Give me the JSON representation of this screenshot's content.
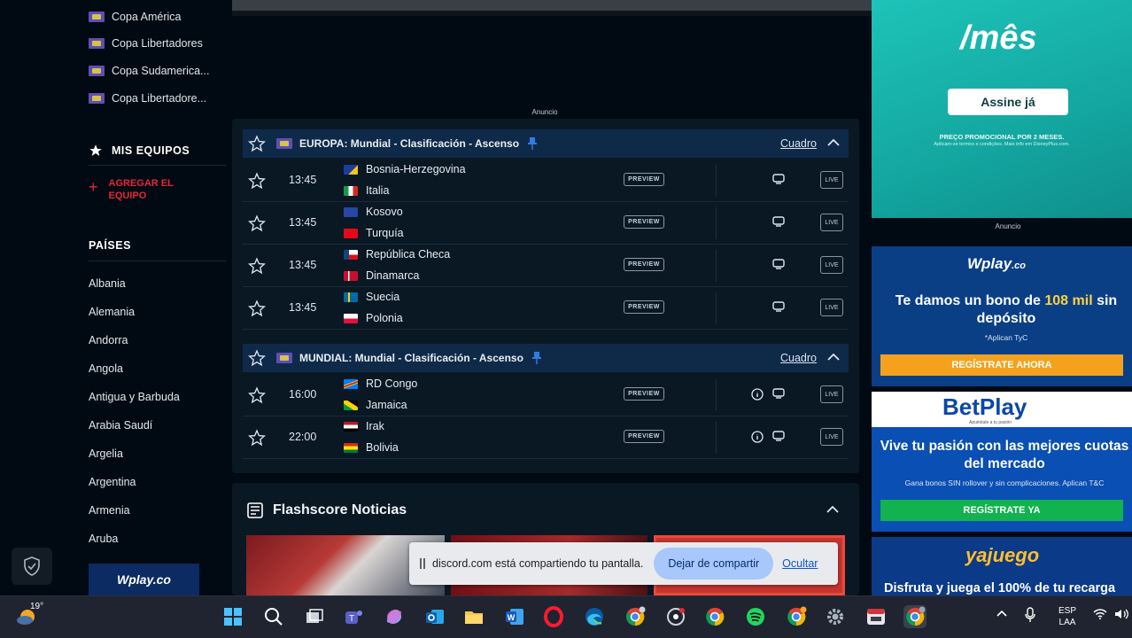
{
  "sidebar": {
    "leagues": [
      "Copa América",
      "Copa Libertadores",
      "Copa Sudamerica...",
      "Copa Libertadore..."
    ],
    "mis_equipos": "MIS EQUIPOS",
    "agregar_equipo": "AGREGAR EL EQUIPO",
    "paises_heading": "PAÍSES",
    "countries": [
      "Albania",
      "Alemania",
      "Andorra",
      "Angola",
      "Antigua y Barbuda",
      "Arabia Saudí",
      "Argelia",
      "Argentina",
      "Armenia",
      "Aruba"
    ],
    "ad_logo": "Wplay.co"
  },
  "main": {
    "anuncio": "Anuncio",
    "groups": [
      {
        "league": "EUROPA: Mundial - Clasificación - Ascenso",
        "cuadro": "Cuadro",
        "matches": [
          {
            "time": "13:45",
            "home": "Bosnia-Herzegovina",
            "away": "Italia",
            "preview": "PREVIEW",
            "live": "LIVE"
          },
          {
            "time": "13:45",
            "home": "Kosovo",
            "away": "Turquía",
            "preview": "PREVIEW",
            "live": "LIVE"
          },
          {
            "time": "13:45",
            "home": "República Checa",
            "away": "Dinamarca",
            "preview": "PREVIEW",
            "live": "LIVE"
          },
          {
            "time": "13:45",
            "home": "Suecia",
            "away": "Polonia",
            "preview": "PREVIEW",
            "live": "LIVE"
          }
        ]
      },
      {
        "league": "MUNDIAL: Mundial - Clasificación - Ascenso",
        "cuadro": "Cuadro",
        "matches": [
          {
            "time": "16:00",
            "home": "RD Congo",
            "away": "Jamaica",
            "preview": "PREVIEW",
            "live": "LIVE"
          },
          {
            "time": "22:00",
            "home": "Irak",
            "away": "Bolivia",
            "preview": "PREVIEW",
            "live": "LIVE"
          }
        ]
      }
    ],
    "news_title": "Flashscore Noticias"
  },
  "share_bar": {
    "text": "discord.com está compartiendo tu pantalla.",
    "stop": "Dejar de compartir",
    "hide": "Ocultar"
  },
  "ads": {
    "disney": {
      "mes": "/mês",
      "assine": "Assine já",
      "promo": "PREÇO PROMOCIONAL POR 2 MESES.",
      "promo2": "Aplicam-se termos e condições. Mais info em DisneyPlus.com."
    },
    "anuncio": "Anuncio",
    "wplay": {
      "logo": "Wplay",
      "logo_suffix": ".co",
      "bono_pre": "Te damos un bono de ",
      "bono_hl": "108 mil",
      "bono_post": " sin depósito",
      "tyc": "*Aplican TyC",
      "cta": "REGÍSTRATE AHORA"
    },
    "betplay": {
      "logo": "BetPlay",
      "tagline": "Apuéstale a tu pasión",
      "vive": "Vive tu pasión con las mejores cuotas del mercado",
      "gana": "Gana bonos SIN rollover y sin complicaciones. Aplican T&C",
      "cta": "REGÍSTRATE YA"
    },
    "yajuego": {
      "logo": "yajuego",
      "text": "Disfruta y juega el 100% de tu recarga"
    }
  },
  "taskbar": {
    "temperature": "19°",
    "lang": "ESP",
    "layout": "LAA"
  },
  "colors": {
    "background": "#010a12",
    "league_bar": "#0f2a49",
    "accent_red": "#e5253a",
    "share_button": "#a8c7fa"
  }
}
